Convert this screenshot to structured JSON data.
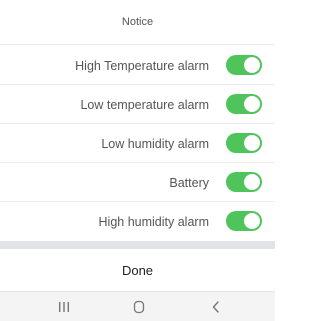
{
  "header": {
    "title": "Notice"
  },
  "alarms": [
    {
      "label": "High Temperature alarm",
      "enabled": true
    },
    {
      "label": "Low temperature alarm",
      "enabled": true
    },
    {
      "label": "Low humidity alarm",
      "enabled": true
    },
    {
      "label": "Battery",
      "enabled": true
    },
    {
      "label": "High humidity alarm",
      "enabled": true
    }
  ],
  "footer": {
    "done_label": "Done"
  },
  "nav": {
    "recent_icon": "recent-apps-icon",
    "home_icon": "home-icon",
    "back_icon": "back-icon"
  },
  "colors": {
    "toggle_on": "#4fc45a",
    "divider": "#e1e3e7"
  }
}
